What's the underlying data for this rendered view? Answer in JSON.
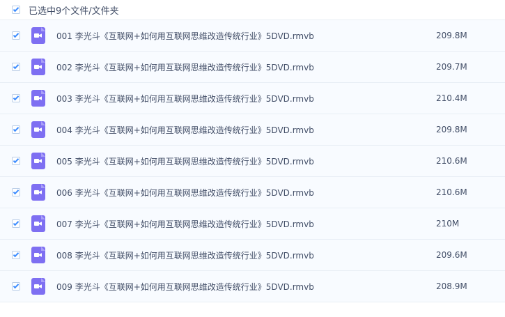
{
  "header": {
    "selection_text": "已选中9个文件/文件夹",
    "select_all_checked": true
  },
  "files": [
    {
      "name": "001 李光斗《互联网+如何用互联网思维改造传统行业》5DVD.rmvb",
      "size": "209.8M",
      "checked": true,
      "icon": "video-file-icon"
    },
    {
      "name": "002 李光斗《互联网+如何用互联网思维改造传统行业》5DVD.rmvb",
      "size": "209.7M",
      "checked": true,
      "icon": "video-file-icon"
    },
    {
      "name": "003 李光斗《互联网+如何用互联网思维改造传统行业》5DVD.rmvb",
      "size": "210.4M",
      "checked": true,
      "icon": "video-file-icon"
    },
    {
      "name": "004 李光斗《互联网+如何用互联网思维改造传统行业》5DVD.rmvb",
      "size": "209.8M",
      "checked": true,
      "icon": "video-file-icon"
    },
    {
      "name": "005 李光斗《互联网+如何用互联网思维改造传统行业》5DVD.rmvb",
      "size": "210.6M",
      "checked": true,
      "icon": "video-file-icon"
    },
    {
      "name": "006 李光斗《互联网+如何用互联网思维改造传统行业》5DVD.rmvb",
      "size": "210.6M",
      "checked": true,
      "icon": "video-file-icon"
    },
    {
      "name": "007 李光斗《互联网+如何用互联网思维改造传统行业》5DVD.rmvb",
      "size": "210M",
      "checked": true,
      "icon": "video-file-icon"
    },
    {
      "name": "008 李光斗《互联网+如何用互联网思维改造传统行业》5DVD.rmvb",
      "size": "209.6M",
      "checked": true,
      "icon": "video-file-icon"
    },
    {
      "name": "009 李光斗《互联网+如何用互联网思维改造传统行业》5DVD.rmvb",
      "size": "208.9M",
      "checked": true,
      "icon": "video-file-icon"
    }
  ],
  "colors": {
    "checkbox_check": "#3b8cff",
    "row_background": "#f8fbff",
    "video_icon": "#7e6ff2",
    "text": "#424e67"
  }
}
